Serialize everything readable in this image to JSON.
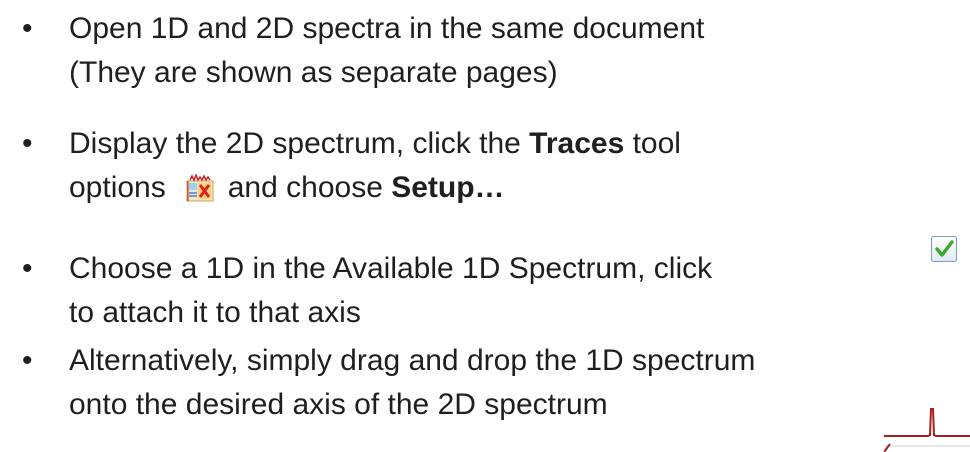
{
  "bullets": [
    {
      "lines": [
        "Open 1D and 2D spectra in the same document",
        "(They are shown as separate pages)"
      ]
    },
    {
      "line1": "Display the 2D spectrum, click the ",
      "line1_bold": "Traces",
      "line1_end": " tool",
      "line2_start": "options",
      "line2_mid": "and choose ",
      "line2_bold": "Setup…"
    },
    {
      "lines": [
        "Choose a 1D in the Available 1D Spectrum, click",
        "to attach it to that axis"
      ]
    },
    {
      "lines": [
        "Alternatively, simply drag and drop the 1D spectrum",
        "onto the desired axis of the 2D spectrum"
      ]
    }
  ],
  "bullet_symbol": "•",
  "icons": {
    "traces_options": "traces-options-icon",
    "attach_check": "checkbox-check-icon",
    "spectrum_peak": "1d-spectrum-peak-icon"
  },
  "colors": {
    "text": "#1f1f1f",
    "check_green": "#3aa82b",
    "spectrum_red": "#a51d1d"
  }
}
